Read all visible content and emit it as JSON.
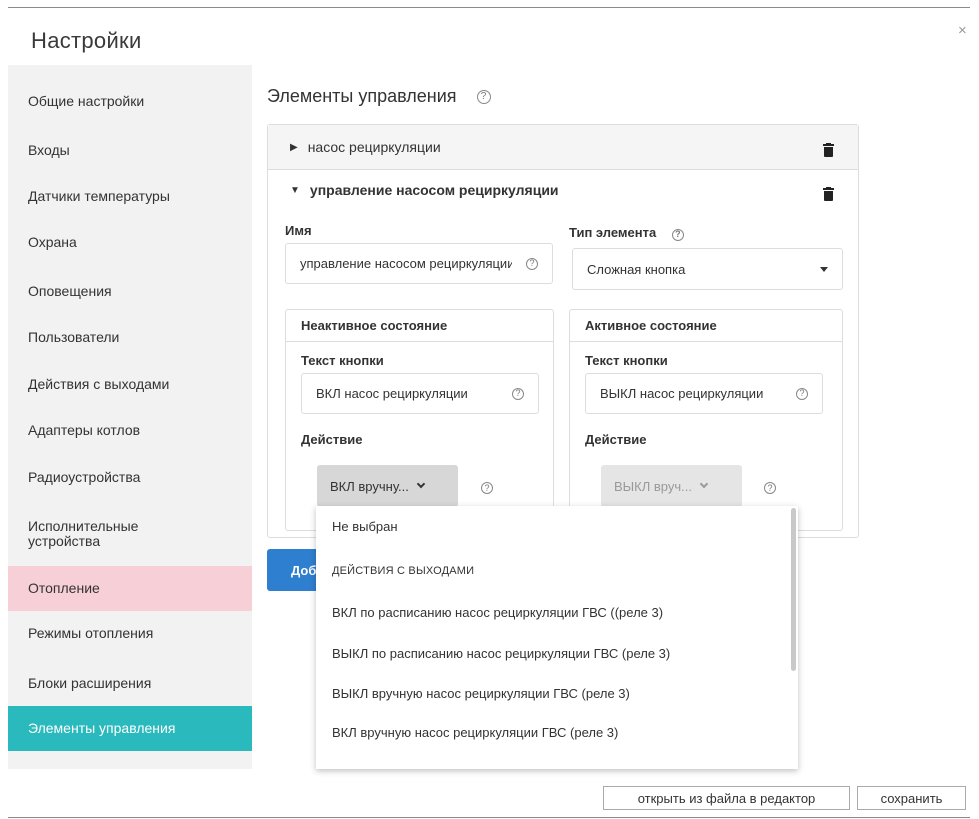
{
  "dialog": {
    "title": "Настройки",
    "close_label": "×"
  },
  "sidebar": {
    "items": [
      {
        "label": "Общие настройки"
      },
      {
        "label": "Входы"
      },
      {
        "label": "Датчики температуры"
      },
      {
        "label": "Охрана"
      },
      {
        "label": "Оповещения"
      },
      {
        "label": "Пользователи"
      },
      {
        "label": "Действия с выходами"
      },
      {
        "label": "Адаптеры котлов"
      },
      {
        "label": "Радиоустройства"
      },
      {
        "label": "Исполнительные устройства"
      },
      {
        "label": "Отопление",
        "state": "highlighted"
      },
      {
        "label": "Режимы отопления"
      },
      {
        "label": "Блоки расширения"
      },
      {
        "label": "Элементы управления",
        "state": "active"
      }
    ]
  },
  "main": {
    "title": "Элементы управления",
    "help_glyph": "?",
    "collapsed_row": {
      "label": "насос рециркуляции"
    },
    "expanded_row": {
      "label": "управление насосом рециркуляции",
      "name_label": "Имя",
      "name_value": "управление насосом рециркуляции",
      "type_label": "Тип элемента",
      "type_value": "Сложная кнопка",
      "inactive": {
        "title": "Неактивное состояние",
        "button_text_label": "Текст кнопки",
        "button_text_value": "ВКЛ насос рециркуляции",
        "action_label": "Действие",
        "action_value": "ВКЛ вручну..."
      },
      "active": {
        "title": "Активное состояние",
        "button_text_label": "Текст кнопки",
        "button_text_value": "ВЫКЛ насос рециркуляции",
        "action_label": "Действие",
        "action_value": "ВЫКЛ вруч..."
      }
    },
    "add_button_label": "Добавить"
  },
  "dropdown": {
    "options": [
      {
        "label": "Не выбран",
        "kind": "option"
      },
      {
        "label": "ДЕЙСТВИЯ С ВЫХОДАМИ",
        "kind": "group"
      },
      {
        "label": "ВКЛ по расписанию насос рециркуляции ГВС ((реле 3)",
        "kind": "option"
      },
      {
        "label": "ВЫКЛ по расписанию насос рециркуляции ГВС (реле 3)",
        "kind": "option"
      },
      {
        "label": "ВЫКЛ вручную насос рециркуляции ГВС (реле 3)",
        "kind": "option"
      },
      {
        "label": "ВКЛ вручную насос рециркуляции ГВС (реле 3)",
        "kind": "option"
      }
    ]
  },
  "footer": {
    "open_file_label": "открыть из файла в редактор",
    "save_label": "сохранить"
  },
  "colors": {
    "active_item_bg": "#2ab9bd",
    "highlight_item_bg": "#f7cfd6",
    "primary_button": "#2f7fd1"
  },
  "icons": [
    "close-icon",
    "help-icon",
    "caret-right-icon",
    "caret-down-icon",
    "trash-icon",
    "chevron-down-icon"
  ]
}
